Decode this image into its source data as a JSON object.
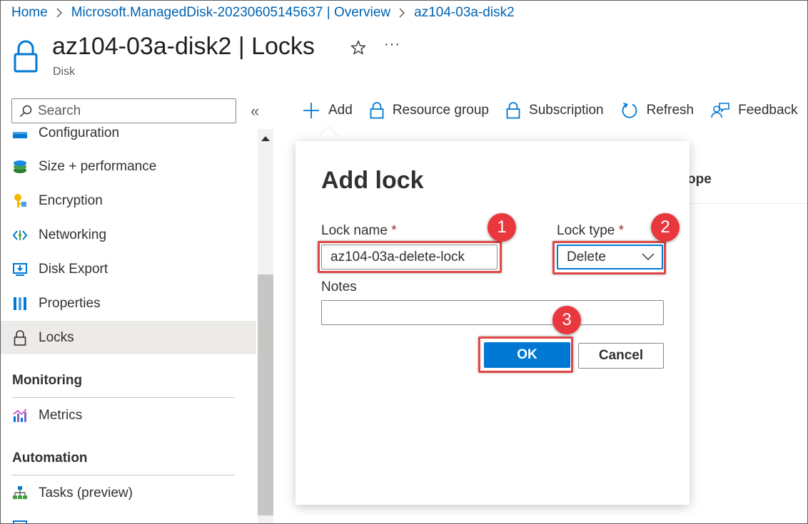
{
  "breadcrumb": {
    "items": [
      "Home",
      "Microsoft.ManagedDisk-20230605145637 | Overview",
      "az104-03a-disk2"
    ]
  },
  "header": {
    "title": "az104-03a-disk2 | Locks",
    "subtitle": "Disk",
    "more": "···",
    "icon": "lock-icon"
  },
  "sidebar": {
    "search_placeholder": "Search",
    "collapse_glyph": "«",
    "items": [
      {
        "label": "Configuration",
        "icon": "configuration-icon"
      },
      {
        "label": "Size + performance",
        "icon": "size-performance-icon"
      },
      {
        "label": "Encryption",
        "icon": "key-icon"
      },
      {
        "label": "Networking",
        "icon": "networking-icon"
      },
      {
        "label": "Disk Export",
        "icon": "export-icon"
      },
      {
        "label": "Properties",
        "icon": "properties-icon"
      },
      {
        "label": "Locks",
        "icon": "lock-icon",
        "active": true
      }
    ],
    "monitoring": {
      "heading": "Monitoring",
      "items": [
        {
          "label": "Metrics",
          "icon": "metrics-icon"
        }
      ]
    },
    "automation": {
      "heading": "Automation",
      "items": [
        {
          "label": "Tasks (preview)",
          "icon": "tasks-icon"
        }
      ]
    }
  },
  "toolbar": {
    "add": "Add",
    "resource_group": "Resource group",
    "subscription": "Subscription",
    "refresh": "Refresh",
    "feedback": "Feedback"
  },
  "content": {
    "scope_header": "ope"
  },
  "dialog": {
    "title": "Add lock",
    "lock_name_label": "Lock name",
    "lock_name_value": "az104-03a-delete-lock",
    "lock_type_label": "Lock type",
    "lock_type_value": "Delete",
    "required_marker": "*",
    "notes_label": "Notes",
    "notes_value": "",
    "ok_label": "OK",
    "cancel_label": "Cancel"
  },
  "callouts": [
    "1",
    "2",
    "3"
  ],
  "colors": {
    "accent": "#0078d4",
    "link": "#0063b1",
    "highlight": "#e04848",
    "callout": "#e8383d"
  }
}
